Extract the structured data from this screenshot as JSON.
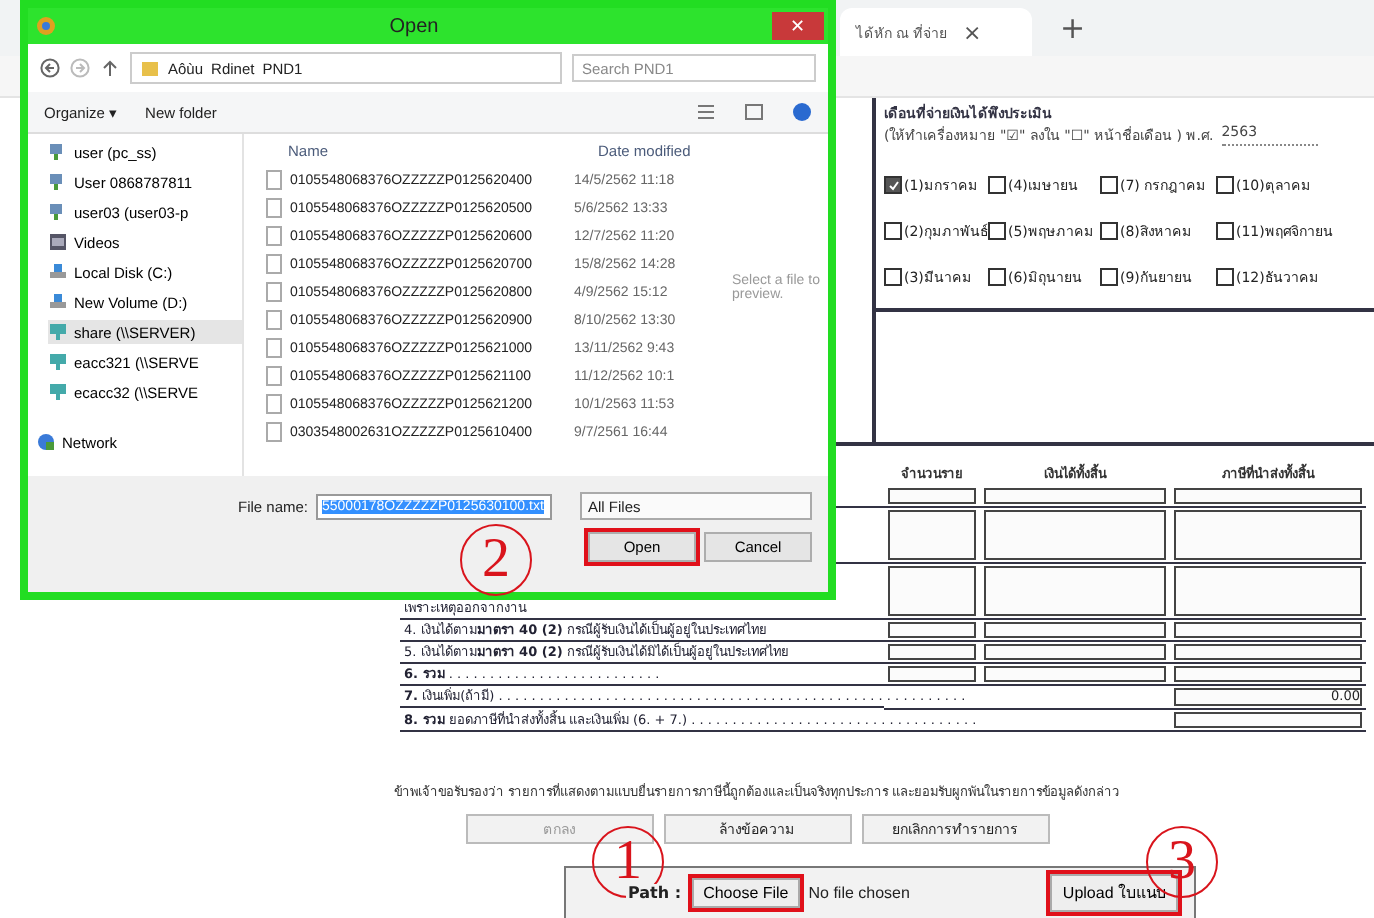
{
  "browser": {
    "tab_title": "ได้หัก ณ ที่จ่าย",
    "tab_close": "×",
    "new_tab": "+"
  },
  "form": {
    "month_heading": "เดือนที่จ่ายเงินได้พึงประเมิน",
    "month_hint": "(ให้ทำเครื่องหมาย \"☑\" ลงใน \"☐\" หน้าชื่อเดือน ) พ.ศ.",
    "year": "2563",
    "months": [
      {
        "label": "(1)มกราคม",
        "checked": true
      },
      {
        "label": "(4)เมษายน",
        "checked": false
      },
      {
        "label": "(7) กรกฎาคม",
        "checked": false
      },
      {
        "label": "(10)ตุลาคม",
        "checked": false
      },
      {
        "label": "(2)กุมภาพันธ์",
        "checked": false
      },
      {
        "label": "(5)พฤษภาคม",
        "checked": false
      },
      {
        "label": "(8)สิงหาคม",
        "checked": false
      },
      {
        "label": "(11)พฤศจิกายน",
        "checked": false
      },
      {
        "label": "(3)มีนาคม",
        "checked": false
      },
      {
        "label": "(6)มิถุนายน",
        "checked": false
      },
      {
        "label": "(9)กันยายน",
        "checked": false
      },
      {
        "label": "(12)ธันวาคม",
        "checked": false
      }
    ],
    "table": {
      "columns": [
        "จำนวนราย",
        "เงินได้ทั้งสิ้น",
        "ภาษีที่นำส่งทั้งสิ้น"
      ],
      "rows": [
        {
          "label": "",
          "kind": "cells",
          "tall": false
        },
        {
          "label": "",
          "kind": "cells",
          "tall": true
        },
        {
          "label": "เพราะเหตุออกจากงาน",
          "kind": "cells",
          "tall": true
        },
        {
          "label": "4. เงินได้ตาม**มาตรา 40 (2)** กรณีผู้รับเงินได้เป็นผู้อยู่ในประเทศไทย",
          "kind": "cells",
          "tall": false
        },
        {
          "label": "5. เงินได้ตาม**มาตรา 40 (2)** กรณีผู้รับเงินได้มิได้เป็นผู้อยู่ในประเทศไทย",
          "kind": "cells",
          "tall": false
        },
        {
          "label": "**6. รวม** . . . . . . . . . . . . . . . . . . . . . . . . . .",
          "kind": "cells",
          "tall": false
        },
        {
          "label": "**7.** เงินเพิ่ม(ถ้ามี) . . . . . . . . . . . . . . . . . . . . . . . . . . . . . . . . . . . . . . . . . . . . . . . . . . . . . . . . .",
          "kind": "total",
          "value": "0.00",
          "tall": false
        },
        {
          "label": "**8. รวม** ยอดภาษีที่นำส่งทั้งสิ้น และเงินเพิ่ม (6. + 7.) . . . . . . . . . . . . . . . . . . . . . . . . . . . . . . . . . . .",
          "kind": "total",
          "value": "",
          "tall": false
        }
      ]
    },
    "declaration": "ข้าพเจ้าขอรับรองว่า รายการที่แสดงตามแบบยื่นรายการภาษีนี้ถูกต้องและเป็นจริงทุกประการ และยอมรับผูกพันในรายการข้อมูลดังกล่าว",
    "buttons": [
      {
        "label": "ตกลง",
        "disabled": true
      },
      {
        "label": "ล้างข้อความ",
        "disabled": false
      },
      {
        "label": "ยกเลิกการทำรายการ",
        "disabled": false
      }
    ],
    "upload": {
      "path_label": "Path :",
      "choose_button": "Choose File",
      "choose_highlighted": true,
      "file_status": "No file chosen",
      "upload_button": "Upload ใบแนบ",
      "upload_highlighted": true
    }
  },
  "dialog": {
    "title": "Open",
    "close_glyph": "✕",
    "breadcrumb": [
      "Aôùu",
      "Rdinet",
      "PND1"
    ],
    "search_placeholder": "Search PND1",
    "organize": "Organize ▾",
    "new_folder": "New folder",
    "nav_items": [
      {
        "label": "user (pc_ss)",
        "kind": "network",
        "selected": false
      },
      {
        "label": "User 0868787811",
        "kind": "network",
        "selected": false
      },
      {
        "label": "user03 (user03-p",
        "kind": "network",
        "selected": false
      },
      {
        "label": "Videos",
        "kind": "folder",
        "selected": false
      },
      {
        "label": "Local Disk (C:)",
        "kind": "disk",
        "selected": false
      },
      {
        "label": "New Volume (D:)",
        "kind": "disk",
        "selected": false
      },
      {
        "label": "share (\\\\SERVER)",
        "kind": "share",
        "selected": true
      },
      {
        "label": "eacc321 (\\\\SERVE",
        "kind": "share",
        "selected": false
      },
      {
        "label": "ecacc32 (\\\\SERVE",
        "kind": "share",
        "selected": false
      },
      {
        "label": "Network",
        "kind": "globe",
        "selected": false
      }
    ],
    "columns": [
      "Name",
      "Date modified"
    ],
    "files": [
      {
        "name": "0105548068376OZZZZZP0125620400",
        "date": "14/5/2562 11:18"
      },
      {
        "name": "0105548068376OZZZZZP0125620500",
        "date": "5/6/2562 13:33"
      },
      {
        "name": "0105548068376OZZZZZP0125620600",
        "date": "12/7/2562 11:20"
      },
      {
        "name": "0105548068376OZZZZZP0125620700",
        "date": "15/8/2562 14:28"
      },
      {
        "name": "0105548068376OZZZZZP0125620800",
        "date": "4/9/2562 15:12"
      },
      {
        "name": "0105548068376OZZZZZP0125620900",
        "date": "8/10/2562 13:30"
      },
      {
        "name": "0105548068376OZZZZZP0125621000",
        "date": "13/11/2562 9:43"
      },
      {
        "name": "0105548068376OZZZZZP0125621100",
        "date": "11/12/2562 10:1"
      },
      {
        "name": "0105548068376OZZZZZP0125621200",
        "date": "10/1/2563 11:53"
      },
      {
        "name": "0303548002631OZZZZZP0125610400",
        "date": "9/7/2561 16:44"
      }
    ],
    "preview": "Select a file to preview.",
    "file_name_label": "File name:",
    "file_name": "55000178OZZZZZP0125630100.txt",
    "file_type": "All Files",
    "open_button": "Open",
    "open_highlighted": true,
    "cancel_button": "Cancel"
  },
  "annotations": [
    "1",
    "2",
    "3"
  ]
}
